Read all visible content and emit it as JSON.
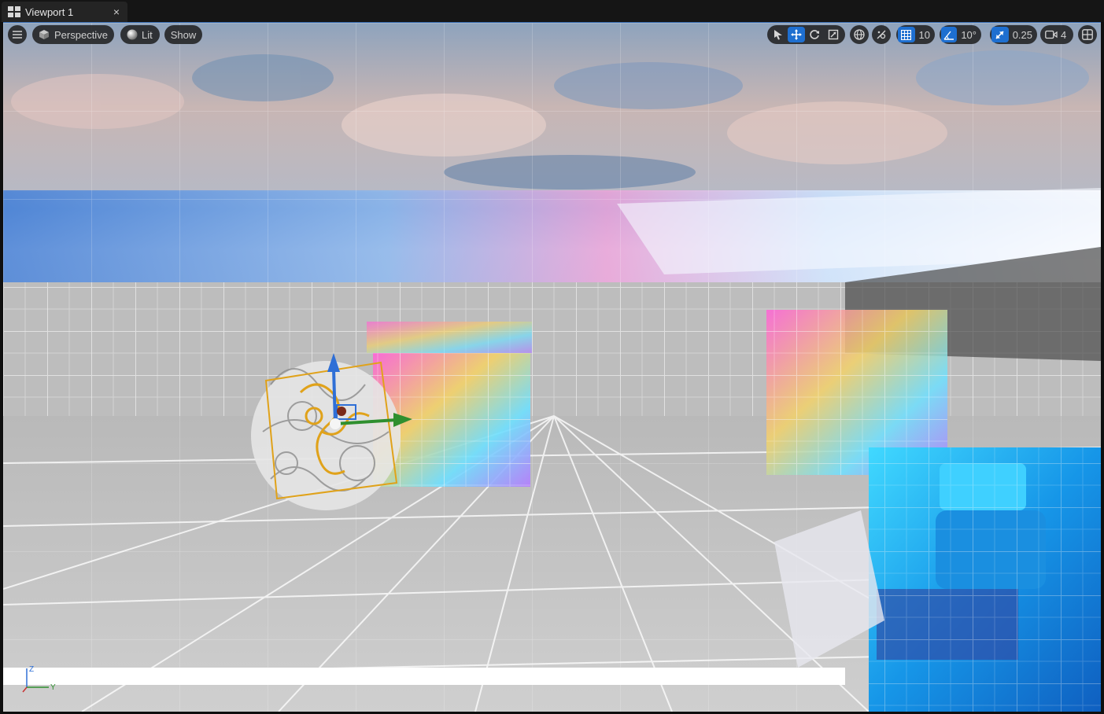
{
  "tab": {
    "title": "Viewport 1",
    "close": "×"
  },
  "toolbar_left": {
    "menu_icon": "hamburger-menu-icon",
    "view_mode": "Perspective",
    "lighting": "Lit",
    "show": "Show"
  },
  "toolbar_right": {
    "grid_snap_value": "10",
    "rotation_snap_value": "10°",
    "scale_snap_value": "0.25",
    "camera_speed_value": "4"
  },
  "axis": {
    "z": "Z",
    "y": "Y"
  },
  "colors": {
    "accent": "#1e6fd0",
    "gizmo_x": "#2f8f2f",
    "gizmo_z": "#2f6fd6",
    "selection": "#e0a21a"
  }
}
